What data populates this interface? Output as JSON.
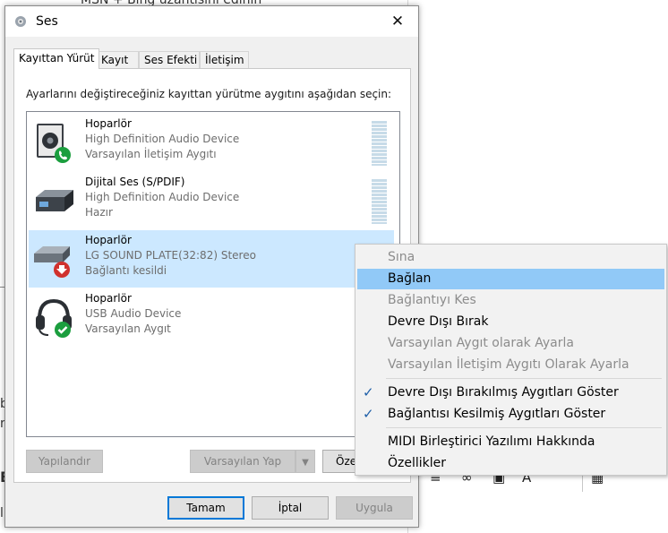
{
  "background": {
    "top_fragment": "MSN + Bing uzantısını edinin",
    "left_fragments": [
      "b",
      "n",
      "B",
      "l"
    ]
  },
  "dialog": {
    "title": "Ses",
    "close_glyph": "✕",
    "tabs": [
      {
        "label": "Kayıttan Yürüt",
        "active": true
      },
      {
        "label": "Kayıt"
      },
      {
        "label": "Ses Efekti"
      },
      {
        "label": "İletişim"
      }
    ],
    "instruction": "Ayarlarını değiştireceğiniz kayıttan yürütme aygıtını aşağıdan seçin:",
    "devices": [
      {
        "name": "Hoparlör",
        "desc": "High Definition Audio Device",
        "status": "Varsayılan İletişim Aygıtı",
        "icon": "speaker-phone-icon",
        "badge": "phone-badge"
      },
      {
        "name": "Dijital Ses (S/PDIF)",
        "desc": "High Definition Audio Device",
        "status": "Hazır",
        "icon": "digital-audio-icon"
      },
      {
        "name": "Hoparlör",
        "desc": "LG SOUND PLATE(32:82) Stereo",
        "status": "Bağlantı kesildi",
        "icon": "sound-plate-icon",
        "badge": "disconnected-badge"
      },
      {
        "name": "Hoparlör",
        "desc": "USB Audio Device",
        "status": "Varsayılan Aygıt",
        "icon": "headset-icon",
        "badge": "default-check-badge"
      }
    ],
    "buttons": {
      "configure": "Yapılandır",
      "set_default": "Varsayılan Yap",
      "properties": "Öze",
      "ok": "Tamam",
      "cancel": "İptal",
      "apply": "Uygula"
    }
  },
  "context_menu": {
    "items": [
      {
        "label": "Sına",
        "state": "disabled"
      },
      {
        "label": "Bağlan",
        "state": "hover"
      },
      {
        "label": "Bağlantıyı Kes",
        "state": "disabled"
      },
      {
        "label": "Devre Dışı Bırak",
        "state": "enabled"
      },
      {
        "label": "Varsayılan Aygıt olarak Ayarla",
        "state": "disabled"
      },
      {
        "label": "Varsayılan İletişim Aygıtı Olarak Ayarla",
        "state": "disabled"
      },
      {
        "label": "Devre Dışı Bırakılmış Aygıtları Göster",
        "state": "checked"
      },
      {
        "label": "Bağlantısı Kesilmiş Aygıtları Göster",
        "state": "checked"
      },
      {
        "label": "MIDI Birleştirici Yazılımı Hakkında",
        "state": "enabled"
      },
      {
        "label": "Özellikler",
        "state": "enabled"
      }
    ],
    "check_glyph": "✓"
  },
  "colors": {
    "selection": "#cce8ff",
    "menu_hover": "#91c9f7",
    "default_button_border": "#0078d7"
  }
}
